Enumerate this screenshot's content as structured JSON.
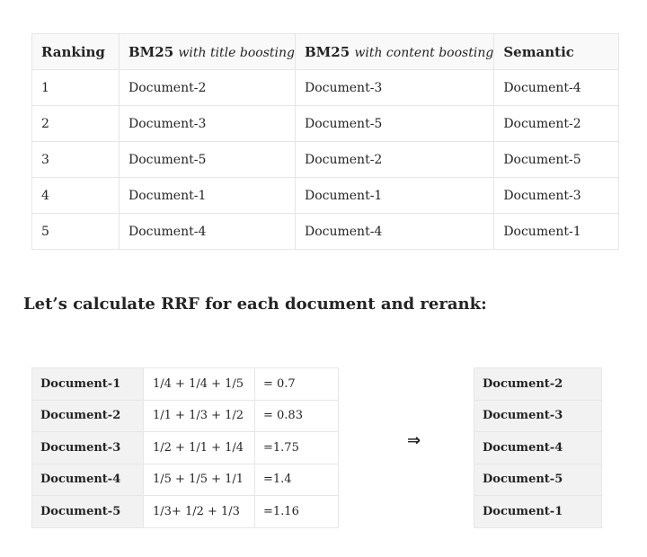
{
  "ranking_table": {
    "headers": {
      "ranking": "Ranking",
      "bm25_title_prefix": "BM25",
      "bm25_title_suffix": "with title boosting",
      "bm25_content_prefix": "BM25",
      "bm25_content_suffix": "with content boosting",
      "semantic": "Semantic"
    },
    "rows": [
      [
        "1",
        "Document-2",
        "Document-3",
        "Document-4"
      ],
      [
        "2",
        "Document-3",
        "Document-5",
        "Document-2"
      ],
      [
        "3",
        "Document-5",
        "Document-2",
        "Document-5"
      ],
      [
        "4",
        "Document-1",
        "Document-1",
        "Document-3"
      ],
      [
        "5",
        "Document-4",
        "Document-4",
        "Document-1"
      ]
    ]
  },
  "heading": "Let’s calculate RRF for each document and rerank:",
  "rrf_table": {
    "rows": [
      [
        "Document-1",
        "1/4 + 1/4 + 1/5",
        "= 0.7"
      ],
      [
        "Document-2",
        "1/1 + 1/3 + 1/2",
        "= 0.83"
      ],
      [
        "Document-3",
        "1/2 + 1/1 + 1/4",
        "=1.75"
      ],
      [
        "Document-4",
        "1/5 + 1/5 + 1/1",
        "=1.4"
      ],
      [
        "Document-5",
        "1/3+ 1/2 + 1/3",
        "=1.16"
      ]
    ]
  },
  "arrow": "⇒",
  "reranked": [
    "Document-2",
    "Document-3",
    "Document-4",
    "Document-5",
    "Document-1"
  ]
}
